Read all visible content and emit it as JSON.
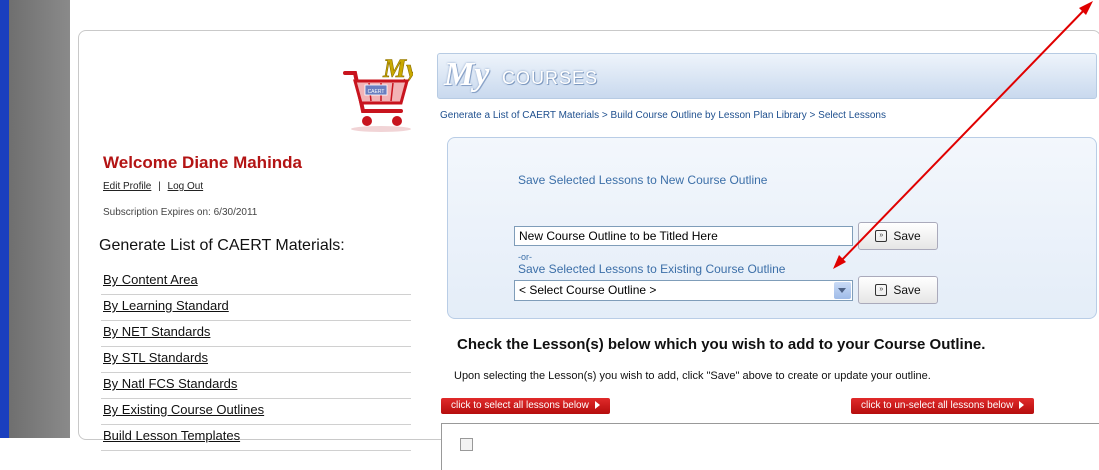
{
  "sidebar": {
    "welcome": "Welcome Diane Mahinda",
    "edit_profile": "Edit Profile",
    "separator": "|",
    "log_out": "Log Out",
    "subscription": "Subscription Expires on: 6/30/2011",
    "generate_title": "Generate List of CAERT Materials:",
    "items": [
      {
        "label": "By Content Area"
      },
      {
        "label": "By Learning Standard"
      },
      {
        "label": "By NET Standards"
      },
      {
        "label": "By STL Standards"
      },
      {
        "label": "By Natl FCS Standards"
      },
      {
        "label": "By Existing Course Outlines"
      },
      {
        "label": "Build Lesson Templates"
      }
    ]
  },
  "logo": {
    "cart_text_my": "My",
    "cart_text_caert": "CAERT"
  },
  "banner": {
    "my": "My",
    "courses": "COURSES"
  },
  "breadcrumb": "Generate a List of CAERT Materials > Build Course Outline by Lesson Plan Library > Select Lessons",
  "save_panel": {
    "new_label": "Save Selected Lessons to New Course Outline",
    "new_value": "New Course Outline to be Titled Here",
    "save_label": "Save",
    "or": "-or-",
    "existing_label": "Save Selected Lessons to Existing Course Outline",
    "select_value": "< Select Course Outline >"
  },
  "instructions": {
    "title": "Check the Lesson(s) below which you wish to add to your Course Outline.",
    "subtitle": "Upon selecting the Lesson(s) you wish to add, click \"Save\" above to create or update your outline."
  },
  "actions": {
    "select_all": "click to select all lessons below",
    "unselect_all": "click to un-select all lessons below"
  },
  "colors": {
    "accent_red": "#cc1a1a",
    "link_blue": "#1e4f8e",
    "panel_blue": "#3c6fa8",
    "annotation_red": "#e00000"
  }
}
